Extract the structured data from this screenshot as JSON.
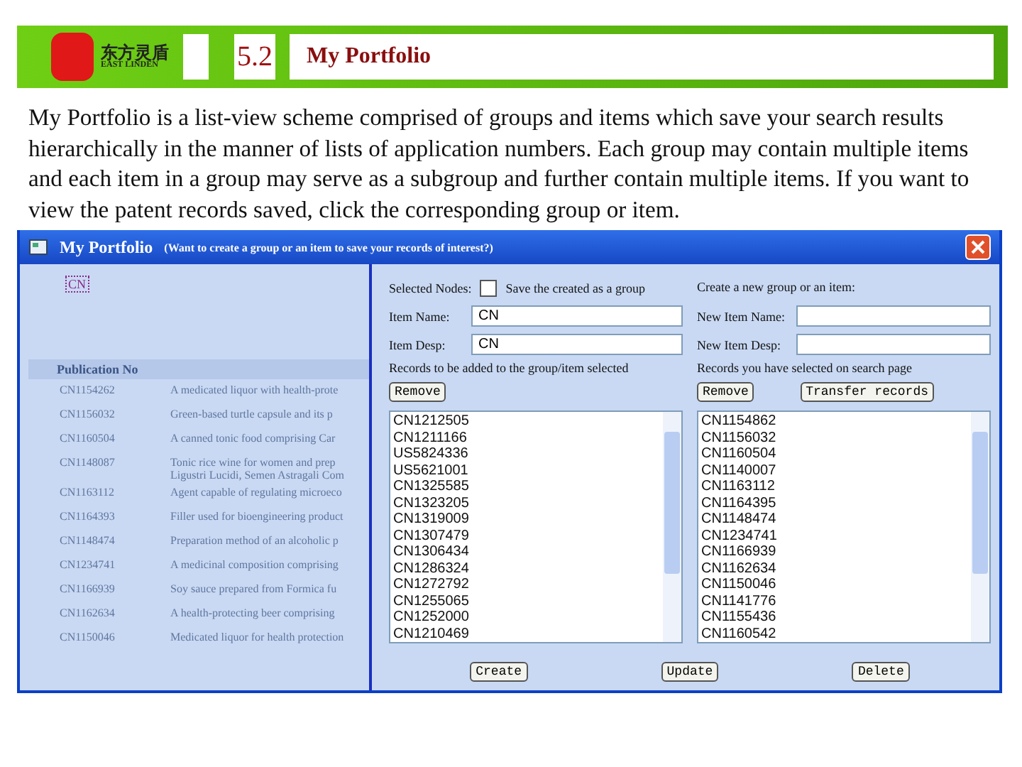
{
  "header": {
    "logo_text": "东方灵盾",
    "logo_subtext": "EAST LINDEN",
    "section_number": "5.2",
    "title": "My Portfolio"
  },
  "intro": "My Portfolio is a list-view scheme comprised of groups and items which save your search results hierarchically in the manner of lists of application numbers. Each group may contain multiple items and each item in a group may serve as a subgroup and further contain multiple items. If you want to view the patent records saved, click the corresponding group or item.",
  "dialog": {
    "title": "My Portfolio",
    "subtitle": "(Want to create a group or an item to save your records of interest?)",
    "tree_node": "CN",
    "background": {
      "column": "Publication No",
      "rows": [
        {
          "number": "CN1154262",
          "title": "A medicated liquor with health-prote"
        },
        {
          "number": "CN1156032",
          "title": "Green-based turtle capsule and its p"
        },
        {
          "number": "CN1160504",
          "title": "A canned tonic food comprising Car"
        },
        {
          "number": "CN1148087",
          "title": "Tonic rice wine for women and prep Ligustri Lucidi, Semen Astragali Com"
        },
        {
          "number": "CN1163112",
          "title": "Agent capable of regulating microeco"
        },
        {
          "number": "CN1164393",
          "title": "Filler used for bioengineering product"
        },
        {
          "number": "CN1148474",
          "title": "Preparation method of an alcoholic p"
        },
        {
          "number": "CN1234741",
          "title": "A medicinal composition comprising"
        },
        {
          "number": "CN1166939",
          "title": "Soy sauce prepared from Formica fu"
        },
        {
          "number": "CN1162634",
          "title": "A health-protecting beer comprising"
        },
        {
          "number": "CN1150046",
          "title": "Medicated liquor for health protection"
        }
      ]
    },
    "left": {
      "selected_nodes_label": "Selected Nodes:",
      "save_as_group": {
        "label": "Save the created as a group",
        "checked": false
      },
      "item_name": {
        "label": "Item Name:",
        "value": "CN"
      },
      "item_desp": {
        "label": "Item Desp:",
        "value": "CN"
      },
      "records_label": "Records to be added to the group/item selected",
      "remove_button": "Remove",
      "records": [
        "CN1212505",
        "CN1211166",
        "US5824336",
        "US5621001",
        "CN1325585",
        "CN1323205",
        "CN1319009",
        "CN1307479",
        "CN1306434",
        "CN1286324",
        "CN1272792",
        "CN1255065",
        "CN1252000",
        "CN1210469"
      ]
    },
    "right": {
      "heading": "Create a new group or an item:",
      "new_item_name": {
        "label": "New Item Name:"
      },
      "new_item_desp": {
        "label": "New Item Desp:"
      },
      "records_label": "Records you have selected on search page",
      "remove_button": "Remove",
      "transfer_button": "Transfer records",
      "records": [
        "CN1154862",
        "CN1156032",
        "CN1160504",
        "CN1140007",
        "CN1163112",
        "CN1164395",
        "CN1148474",
        "CN1234741",
        "CN1166939",
        "CN1162634",
        "CN1150046",
        "CN1141776",
        "CN1155436",
        "CN1160542"
      ]
    },
    "buttons": [
      "Create",
      "Update",
      "Delete"
    ]
  }
}
